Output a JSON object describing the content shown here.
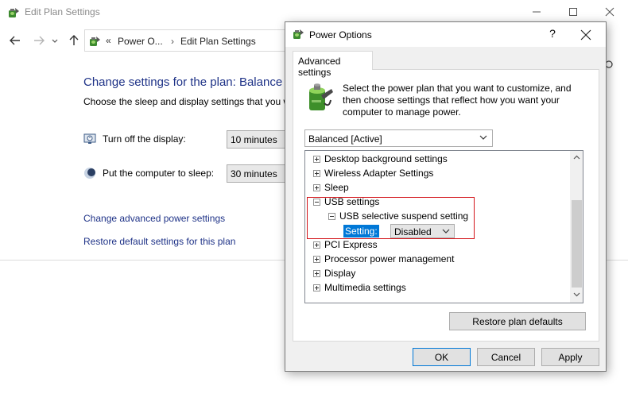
{
  "background_window": {
    "title": "Edit Plan Settings",
    "address": {
      "chevron": "«",
      "part1": "Power O...",
      "separator": "›",
      "part2": "Edit Plan Settings"
    },
    "heading": "Change settings for the plan: Balance",
    "subheading": "Choose the sleep and display settings that you w",
    "display_label": "Turn off the display:",
    "display_value": "10 minutes",
    "sleep_label": "Put the computer to sleep:",
    "sleep_value": "30 minutes",
    "advanced_link": "Change advanced power settings",
    "restore_link": "Restore default settings for this plan"
  },
  "dialog": {
    "title": "Power Options",
    "help_label": "?",
    "tab_label": "Advanced settings",
    "description": "Select the power plan that you want to customize, and then choose settings that reflect how you want your computer to manage power.",
    "plan_select_value": "Balanced [Active]",
    "tree": {
      "items": [
        {
          "label": "Desktop background settings",
          "expanded": false
        },
        {
          "label": "Wireless Adapter Settings",
          "expanded": false
        },
        {
          "label": "Sleep",
          "expanded": false
        },
        {
          "label": "USB settings",
          "expanded": true
        },
        {
          "label": "USB selective suspend setting",
          "expanded": true
        },
        {
          "label": "PCI Express",
          "expanded": false
        },
        {
          "label": "Processor power management",
          "expanded": false
        },
        {
          "label": "Display",
          "expanded": false
        },
        {
          "label": "Multimedia settings",
          "expanded": false
        }
      ],
      "setting_label": "Setting:",
      "setting_value": "Disabled"
    },
    "restore_defaults_label": "Restore plan defaults",
    "ok_label": "OK",
    "cancel_label": "Cancel",
    "apply_label": "Apply"
  },
  "colors": {
    "link_blue": "#1e3287",
    "selection_blue": "#0078d7",
    "highlight_red": "#d4161c"
  },
  "icons": {
    "power_options": "battery-plug-icon",
    "monitor": "monitor-icon",
    "moon": "sleep-moon-icon"
  }
}
